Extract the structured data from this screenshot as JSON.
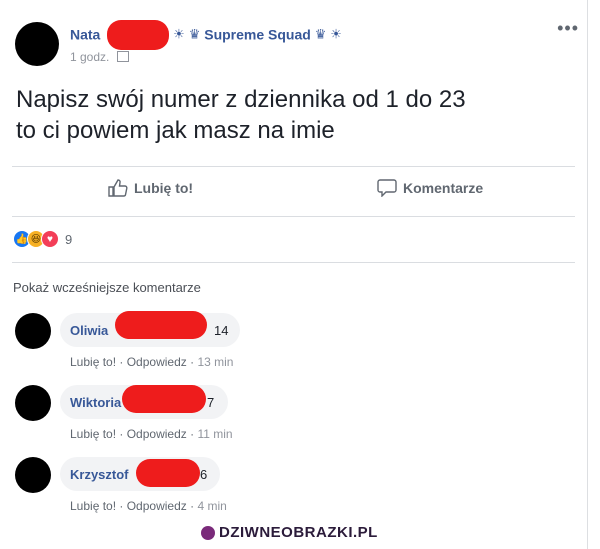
{
  "post": {
    "author": "Nata",
    "group": "Supreme Squad",
    "time": "1 godz.",
    "text_line1": "Napisz swój numer z dziennika od 1 do 23",
    "text_line2": "to ci powiem jak masz na imie",
    "like_label": "Lubię to!",
    "comment_label": "Komentarze",
    "reaction_count": "9"
  },
  "comments_section": {
    "show_previous": "Pokaż wcześniejsze komentarze",
    "items": [
      {
        "name": "Oliwia",
        "text": "14",
        "like": "Lubię to!",
        "reply": "Odpowiedz",
        "time": "13 min"
      },
      {
        "name": "Wiktoria",
        "text": "7",
        "like": "Lubię to!",
        "reply": "Odpowiedz",
        "time": "11 min"
      },
      {
        "name": "Krzysztof",
        "text": "6",
        "like": "Lubię to!",
        "reply": "Odpowiedz",
        "time": "4 min"
      }
    ]
  },
  "watermark": "DZIWNEOBRAZKI.PL",
  "colors": {
    "link_blue": "#385898",
    "redaction": "#ee1c1c",
    "like_reaction": "#1877f2",
    "haha_reaction": "#f7b125",
    "love_reaction": "#f33e58"
  }
}
